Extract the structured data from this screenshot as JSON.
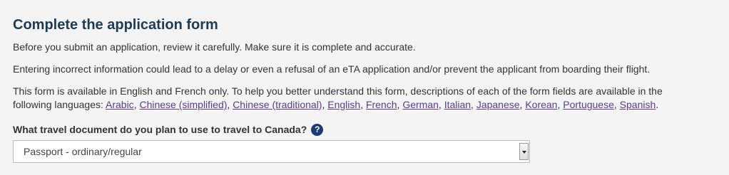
{
  "section": {
    "title": "Complete the application form",
    "paragraph1": "Before you submit an application, review it carefully. Make sure it is complete and accurate.",
    "paragraph2": "Entering incorrect information could lead to a delay or even a refusal of an eTA application and/or prevent the applicant from boarding their flight.",
    "paragraph3_text": "This form is available in English and French only. To help you better understand this form, descriptions of each of the form fields are available in the following languages: ",
    "languages": [
      "Arabic",
      "Chinese (simplified)",
      "Chinese (traditional)",
      "English",
      "French",
      "German",
      "Italian",
      "Japanese",
      "Korean",
      "Portuguese",
      "Spanish"
    ],
    "languages_separator": ", ",
    "languages_end": "."
  },
  "question": {
    "label": "What travel document do you plan to use to travel to Canada?",
    "help_icon": "question-circle-icon",
    "help_glyph": "?"
  },
  "travel_document_select": {
    "selected": "Passport - ordinary/regular",
    "arrow_icon": "dropdown-arrow-icon"
  },
  "colors": {
    "title": "#1c3b55",
    "link": "#5a3c8c",
    "help_icon_bg": "#1c3b75",
    "background": "#f4f4f4"
  }
}
